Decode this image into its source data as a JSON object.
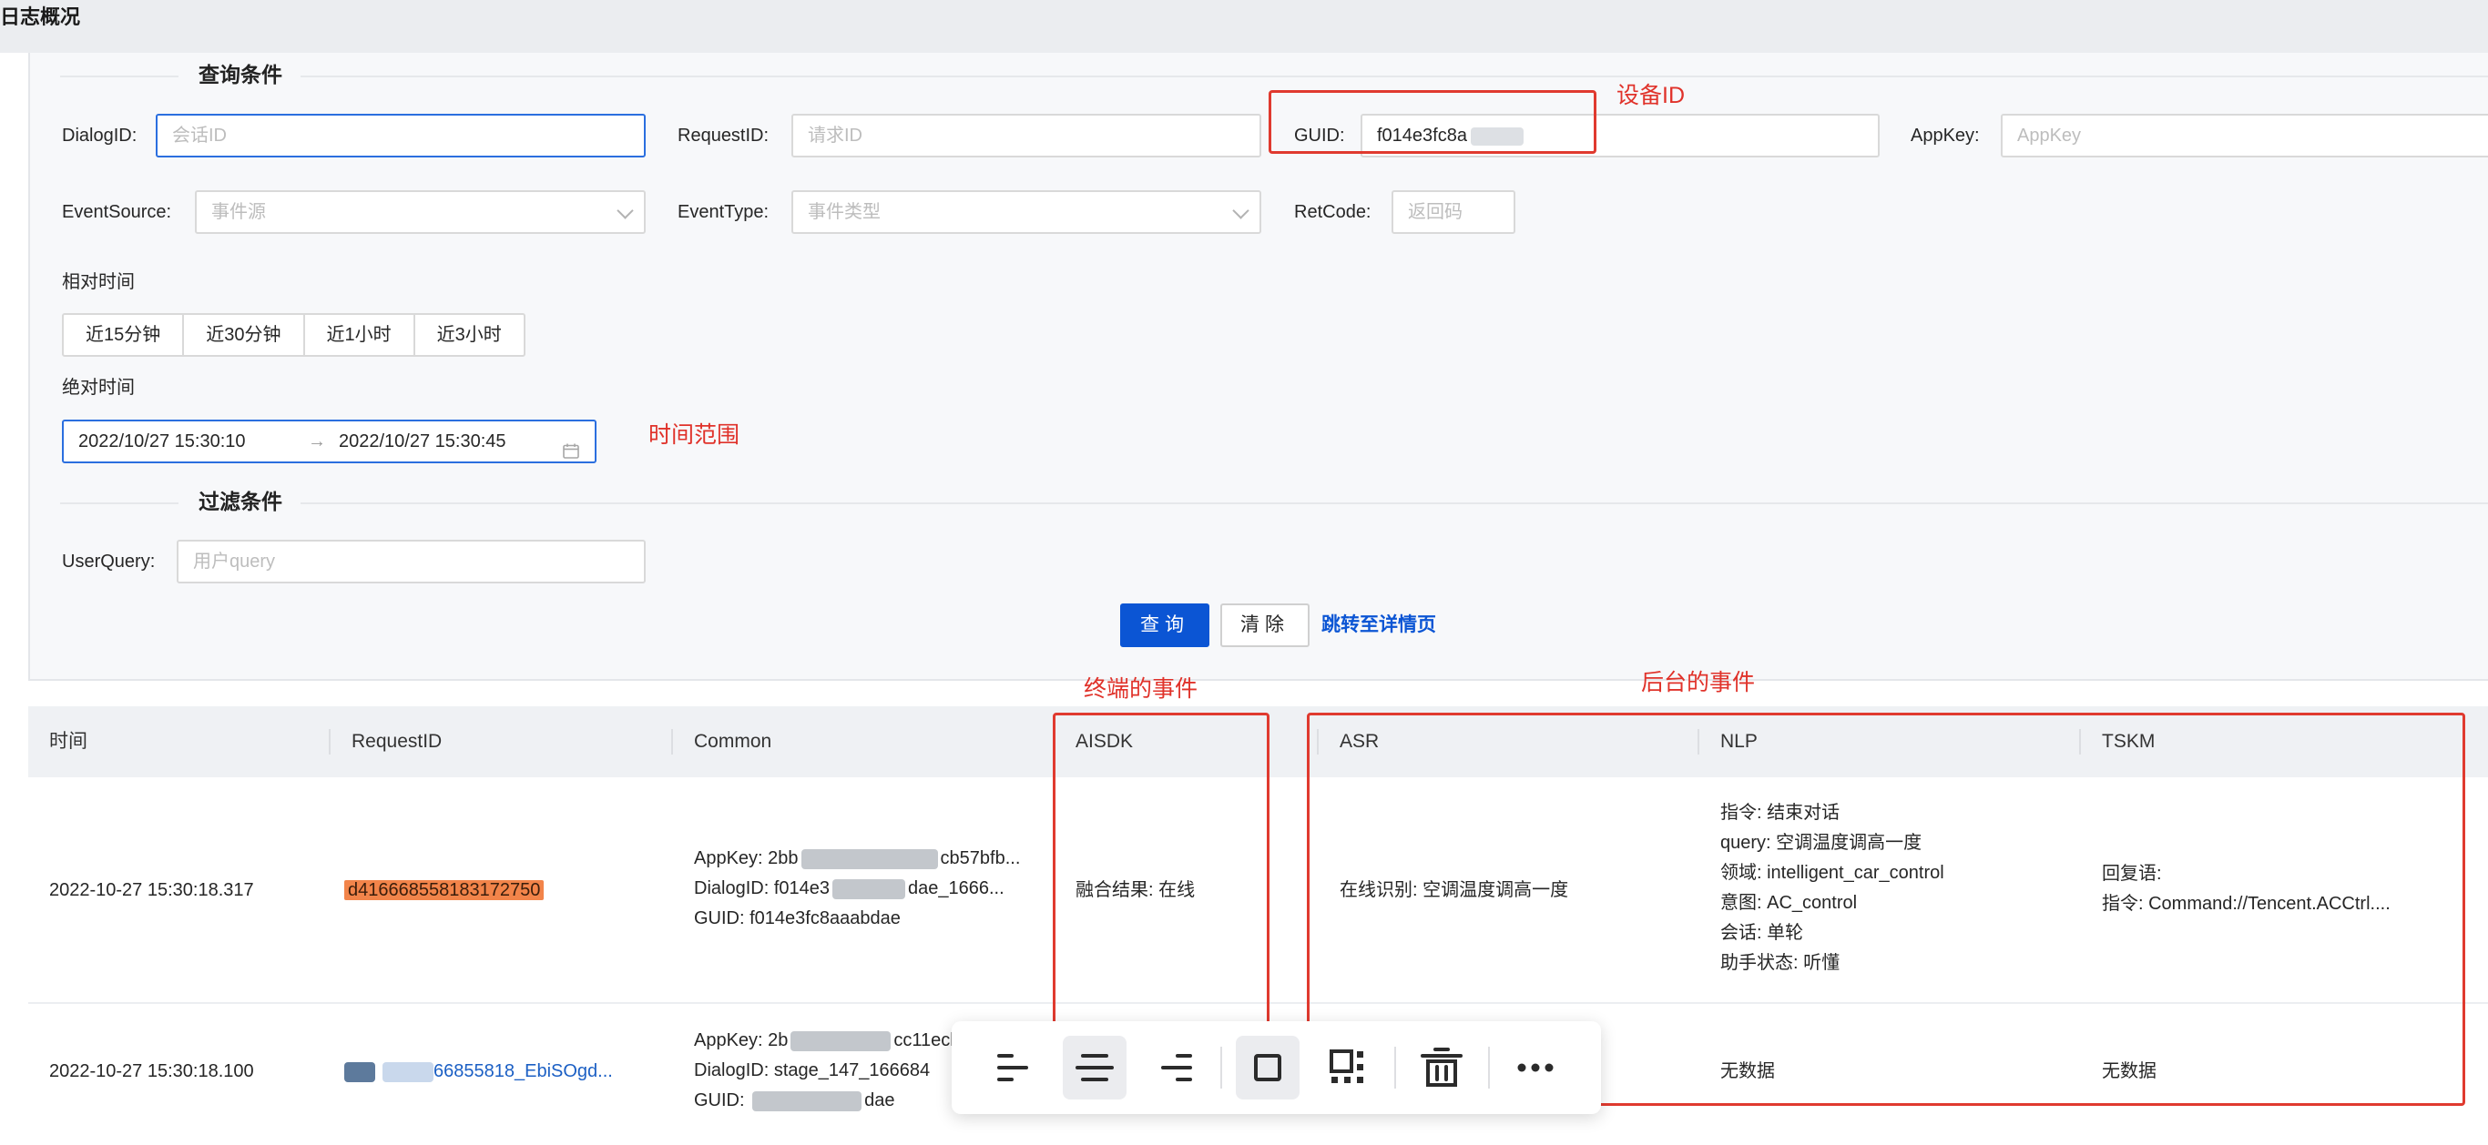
{
  "page": {
    "title": "日志概况"
  },
  "query_section": {
    "title": "查询条件"
  },
  "filters": {
    "dialog_id": {
      "label": "DialogID:",
      "placeholder": "会话ID",
      "value": ""
    },
    "request_id": {
      "label": "RequestID:",
      "placeholder": "请求ID",
      "value": ""
    },
    "guid": {
      "label": "GUID:",
      "value": "f014e3fc8a"
    },
    "app_key": {
      "label": "AppKey:",
      "placeholder": "AppKey",
      "value": ""
    },
    "event_source": {
      "label": "EventSource:",
      "placeholder": "事件源"
    },
    "event_type": {
      "label": "EventType:",
      "placeholder": "事件类型"
    },
    "ret_code": {
      "label": "RetCode:",
      "placeholder": "返回码",
      "value": ""
    }
  },
  "relative_time": {
    "label": "相对时间",
    "options": [
      "近15分钟",
      "近30分钟",
      "近1小时",
      "近3小时"
    ]
  },
  "absolute_time": {
    "label": "绝对时间",
    "start": "2022/10/27 15:30:10",
    "arrow": "→",
    "end": "2022/10/27 15:30:45"
  },
  "filter_section": {
    "title": "过滤条件"
  },
  "user_query": {
    "label": "UserQuery:",
    "placeholder": "用户query",
    "value": ""
  },
  "actions": {
    "query": "查询",
    "clear": "清除",
    "detail_link": "跳转至详情页"
  },
  "annotations": {
    "device_id": "设备ID",
    "time_range": "时间范围",
    "client_events": "终端的事件",
    "backend_events": "后台的事件"
  },
  "table": {
    "columns": [
      "时间",
      "RequestID",
      "Common",
      "AISDK",
      "ASR",
      "NLP",
      "TSKM"
    ],
    "rows": [
      {
        "time": "2022-10-27 15:30:18.317",
        "request_id": "d4166685581831727 50",
        "request_id_visible": "d416668558183172750",
        "common": [
          "AppKey: 2bb",
          "cb57bfb...",
          "DialogID: f014e3",
          "dae_1666...",
          "GUID: f014e3fc8aaabdae"
        ],
        "aisdk": "融合结果: 在线",
        "asr": "在线识别: 空调温度调高一度",
        "nlp": [
          "指令: 结束对话",
          "query: 空调温度调高一度",
          "领域: intelligent_car_control",
          "意图: AC_control",
          "会话: 单轮",
          "助手状态: 听懂"
        ],
        "tskm": [
          "回复语:",
          "指令: Command://Tencent.ACCtrl...."
        ]
      },
      {
        "time": "2022-10-27 15:30:18.100",
        "request_id_visible": "66855818_EbiSOgd...",
        "common": [
          "AppKey: 2b",
          "cc11ecl",
          "DialogID: stage_147_166684",
          "GUID: ",
          "dae"
        ],
        "nlp": "无数据",
        "tskm": "无数据"
      }
    ]
  },
  "toolbar": {
    "buttons": [
      "align-left-icon",
      "align-center-icon",
      "align-right-icon",
      "frame-icon",
      "qr-layout-icon",
      "delete-icon",
      "more-icon"
    ]
  }
}
